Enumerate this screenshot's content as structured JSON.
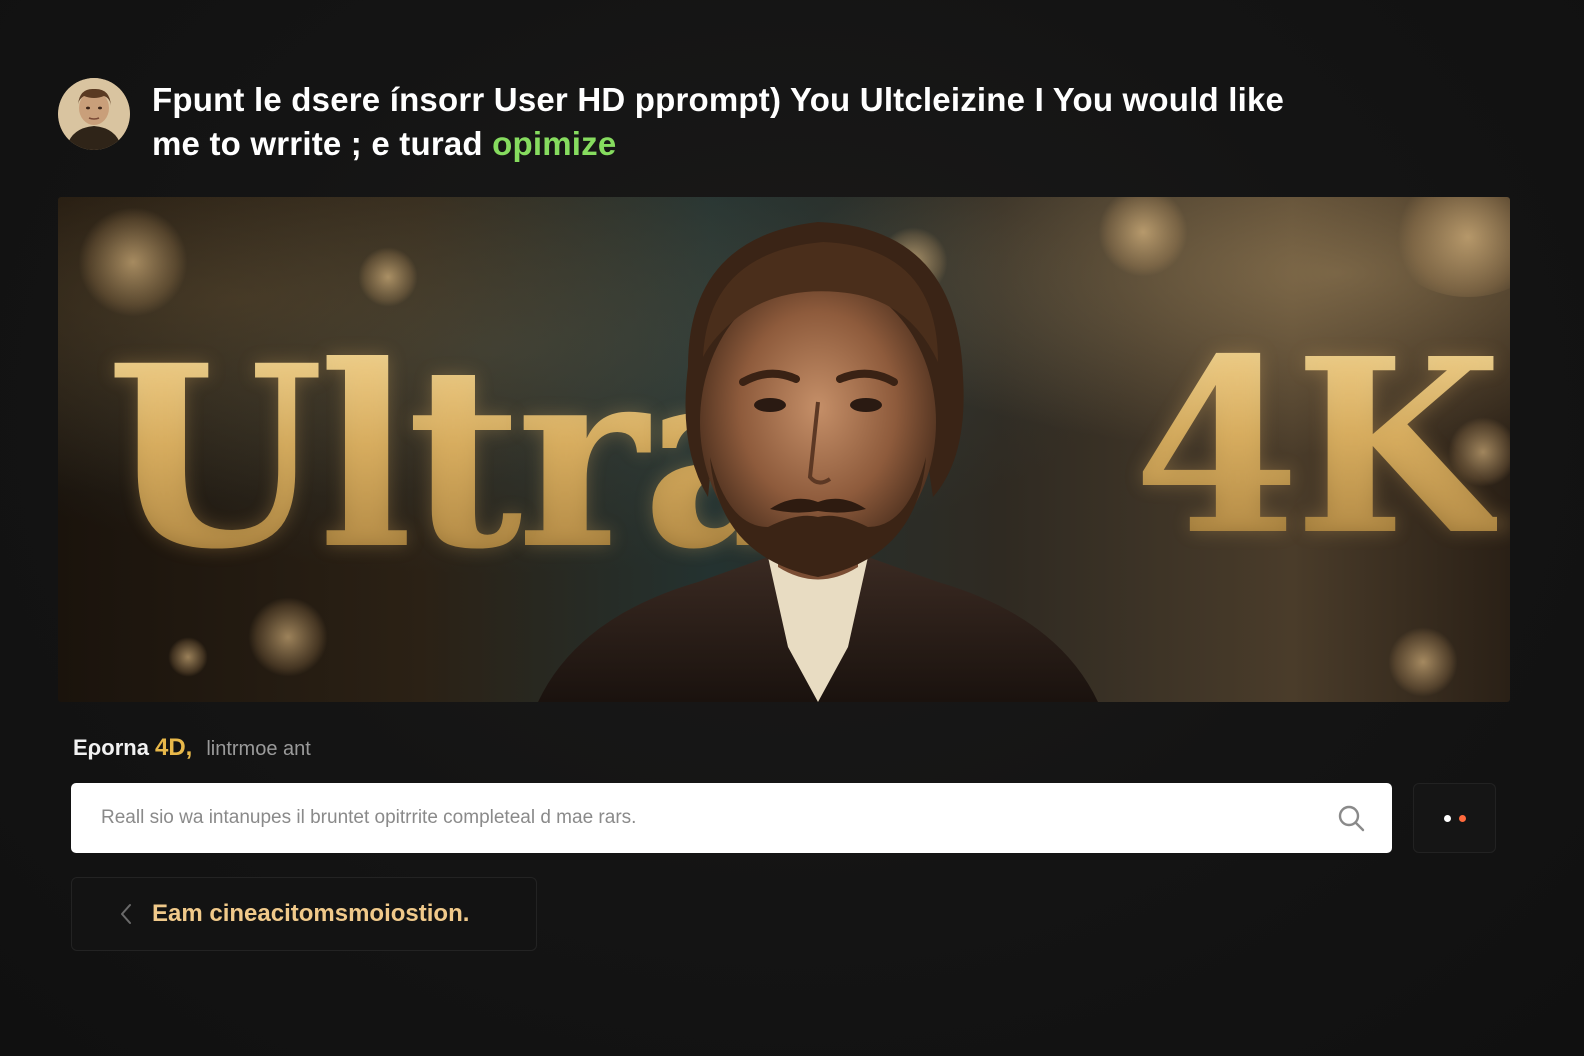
{
  "message": {
    "line1": "Fpunt le dsere ínsorr User HD pprompt) You Ultcleizine I You would like",
    "line2_prefix": "me to wrrite ; e turad",
    "line2_highlight": "opimize",
    "avatar_icon": "avatar-photo",
    "highlight_color": "#86dc5f"
  },
  "hero": {
    "word_left": "Ultra",
    "word_right": "4K",
    "text_color": "#caa45a"
  },
  "caption": {
    "part1": "Ερorna",
    "part2": "4D,",
    "part3": "lintrmoe ant",
    "accent_color": "#e8b84a"
  },
  "search": {
    "placeholder": "Reall sio wa intanupes il bruntet opitrrite completeal d mae rars.",
    "value": "",
    "icon": "search-icon"
  },
  "more_button": {
    "icon": "more-dots-icon",
    "dot_colors": [
      "#ffffff",
      "#ff6a3d"
    ]
  },
  "suggestion": {
    "label": "Eam cineacitomsmoiostion.",
    "icon": "chevron-left-icon",
    "color": "#f0c98a"
  }
}
